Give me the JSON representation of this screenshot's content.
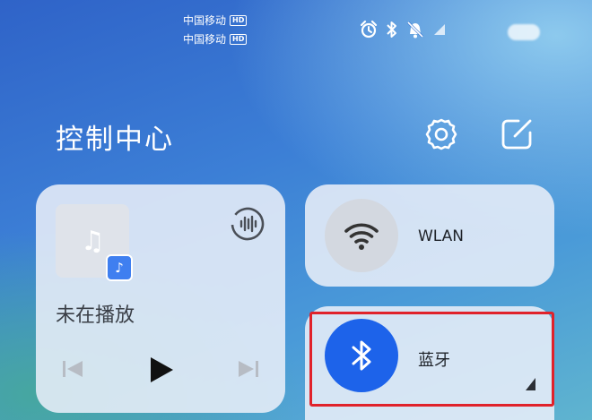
{
  "status_bar": {
    "carriers": [
      {
        "name": "中国移动",
        "badge": "HD"
      },
      {
        "name": "中国移动",
        "badge": "HD"
      }
    ],
    "icons": [
      "alarm-icon",
      "bluetooth-icon",
      "mute-bell-icon",
      "signal-icon"
    ]
  },
  "header": {
    "title": "控制中心",
    "settings_icon": "gear-icon",
    "edit_icon": "edit-icon"
  },
  "media_card": {
    "status": "未在播放",
    "app_icon": "music-app-icon",
    "controls": [
      "previous-icon",
      "play-icon",
      "next-icon"
    ]
  },
  "tiles": [
    {
      "label": "WLAN",
      "icon": "wifi-icon",
      "active": false
    },
    {
      "label": "蓝牙",
      "icon": "bluetooth-icon",
      "active": true
    }
  ],
  "colors": {
    "accent": "#1d63ea",
    "highlight": "#e0222b"
  }
}
